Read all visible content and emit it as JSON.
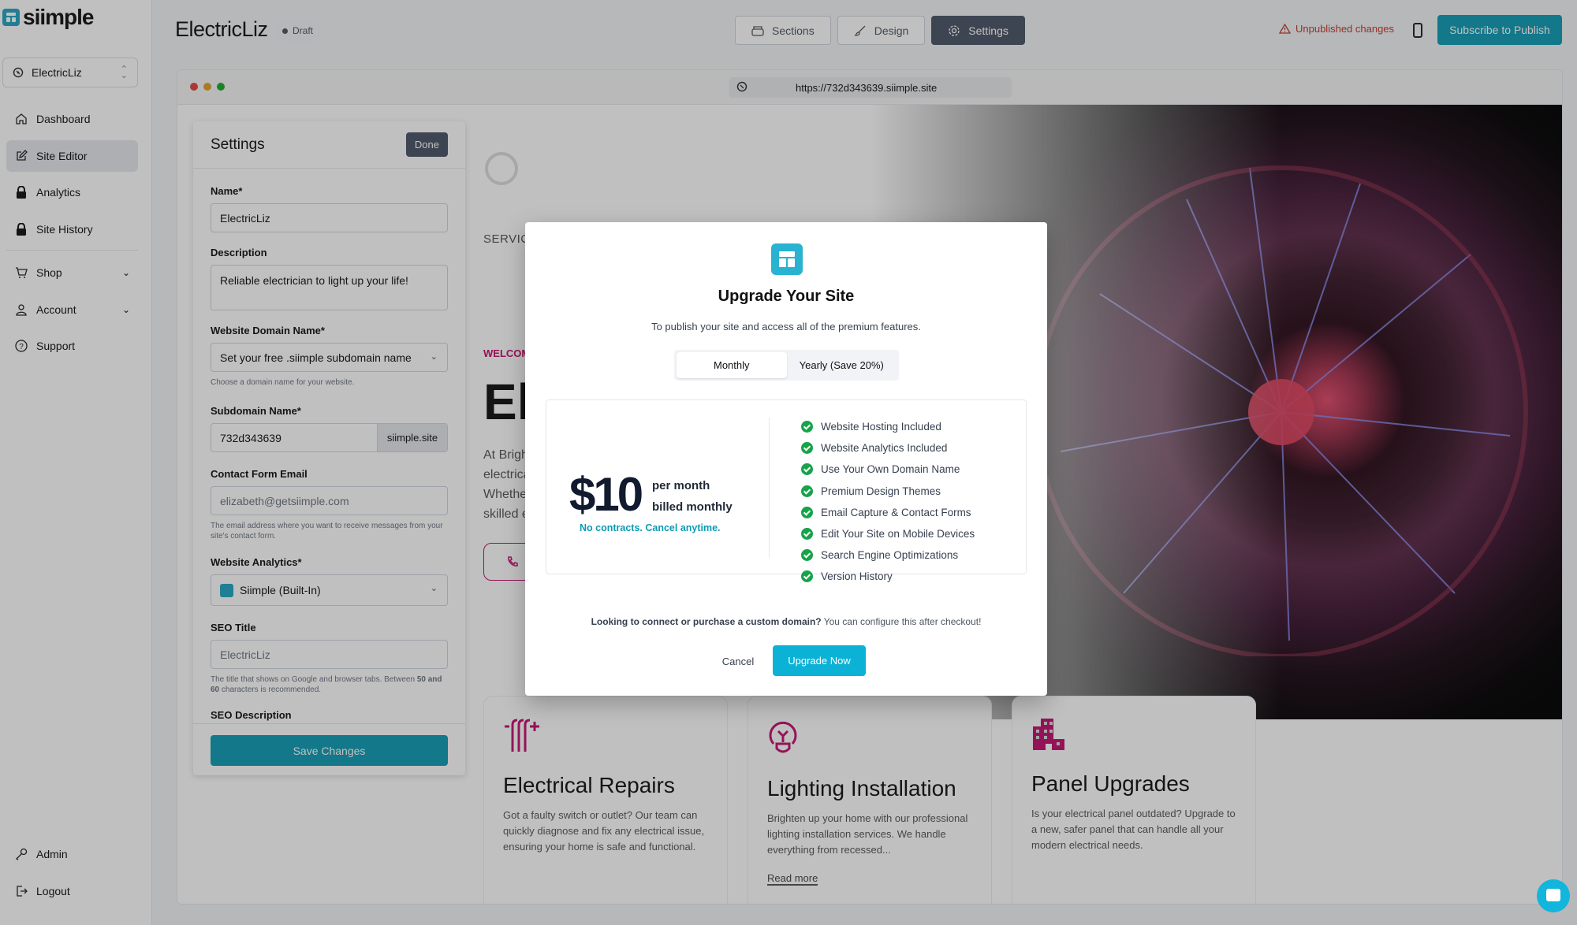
{
  "brand": {
    "name": "siimple",
    "accent": "#0e9bb4"
  },
  "sidebar": {
    "site_selector": "ElectricLiz",
    "items": [
      {
        "label": "Dashboard",
        "icon": "home-icon"
      },
      {
        "label": "Site Editor",
        "icon": "edit-icon",
        "active": true
      },
      {
        "label": "Analytics",
        "icon": "lock-icon"
      },
      {
        "label": "Site History",
        "icon": "lock-icon"
      }
    ],
    "groups": [
      {
        "label": "Shop",
        "icon": "cart-icon"
      },
      {
        "label": "Account",
        "icon": "user-icon"
      },
      {
        "label": "Support",
        "icon": "help-icon"
      }
    ],
    "bottom": [
      {
        "label": "Admin",
        "icon": "key-icon"
      },
      {
        "label": "Logout",
        "icon": "logout-icon"
      }
    ]
  },
  "header": {
    "title": "ElectricLiz",
    "status": "Draft",
    "tabs": [
      {
        "label": "Sections",
        "icon": "archive-icon"
      },
      {
        "label": "Design",
        "icon": "brush-icon"
      },
      {
        "label": "Settings",
        "icon": "gear-icon",
        "active": true
      }
    ],
    "unpublished": "Unpublished changes",
    "publish_button": "Subscribe to Publish"
  },
  "browser": {
    "url": "https://732d343639.siimple.site"
  },
  "settings_panel": {
    "title": "Settings",
    "done": "Done",
    "name_label": "Name*",
    "name_value": "ElectricLiz",
    "description_label": "Description",
    "description_value": "Reliable electrician to light up your life!",
    "domain_label": "Website Domain Name*",
    "domain_value": "Set your free .siimple subdomain name",
    "domain_hint": "Choose a domain name for your website.",
    "subdomain_label": "Subdomain Name*",
    "subdomain_value": "732d343639",
    "subdomain_suffix": "siimple.site",
    "email_label": "Contact Form Email",
    "email_placeholder": "elizabeth@getsiimple.com",
    "email_hint": "The email address where you want to receive messages from your site's contact form.",
    "analytics_label": "Website Analytics*",
    "analytics_value": "Siimple (Built-In)",
    "seo_title_label": "SEO Title",
    "seo_title_placeholder": "ElectricLiz",
    "seo_hint_pre": "The title that shows on Google and browser tabs. Between ",
    "seo_hint_bold": "50 and 60",
    "seo_hint_post": " characters is recommended.",
    "seo_desc_label": "SEO Description",
    "save": "Save Changes"
  },
  "site_preview": {
    "nav_label": "SERVICE",
    "welcome": "WELCOM",
    "hero_heading": "El",
    "hero_text": [
      "At Brigh",
      "electrica",
      "Whethe",
      "skilled e"
    ],
    "cards": [
      {
        "title": "Electrical Repairs",
        "text": "Got a faulty switch or outlet? Our team can quickly diagnose and fix any electrical issue, ensuring your home is safe and functional.",
        "icon": "wires-icon"
      },
      {
        "title": "Lighting Installation",
        "text": "Brighten up your home with our professional lighting installation services. We handle everything from recessed...",
        "link": "Read more",
        "icon": "lightbulb-icon"
      },
      {
        "title": "Panel Upgrades",
        "text": "Is your electrical panel outdated? Upgrade to a new, safer panel that can handle all your modern electrical needs.",
        "icon": "building-icon"
      }
    ]
  },
  "modal": {
    "title": "Upgrade Your Site",
    "subtitle": "To publish your site and access all of the premium features.",
    "billing": [
      {
        "label": "Monthly",
        "selected": true
      },
      {
        "label": "Yearly (Save 20%)",
        "selected": false
      }
    ],
    "price": "$10",
    "per": "per month",
    "billed": "billed monthly",
    "no_contract": "No contracts. Cancel anytime.",
    "features": [
      "Website Hosting Included",
      "Website Analytics Included",
      "Use Your Own Domain Name",
      "Premium Design Themes",
      "Email Capture & Contact Forms",
      "Edit Your Site on Mobile Devices",
      "Search Engine Optimizations",
      "Version History"
    ],
    "note_bold": "Looking to connect or purchase a custom domain?",
    "note_rest": " You can configure this after checkout!",
    "cancel": "Cancel",
    "upgrade": "Upgrade Now"
  }
}
